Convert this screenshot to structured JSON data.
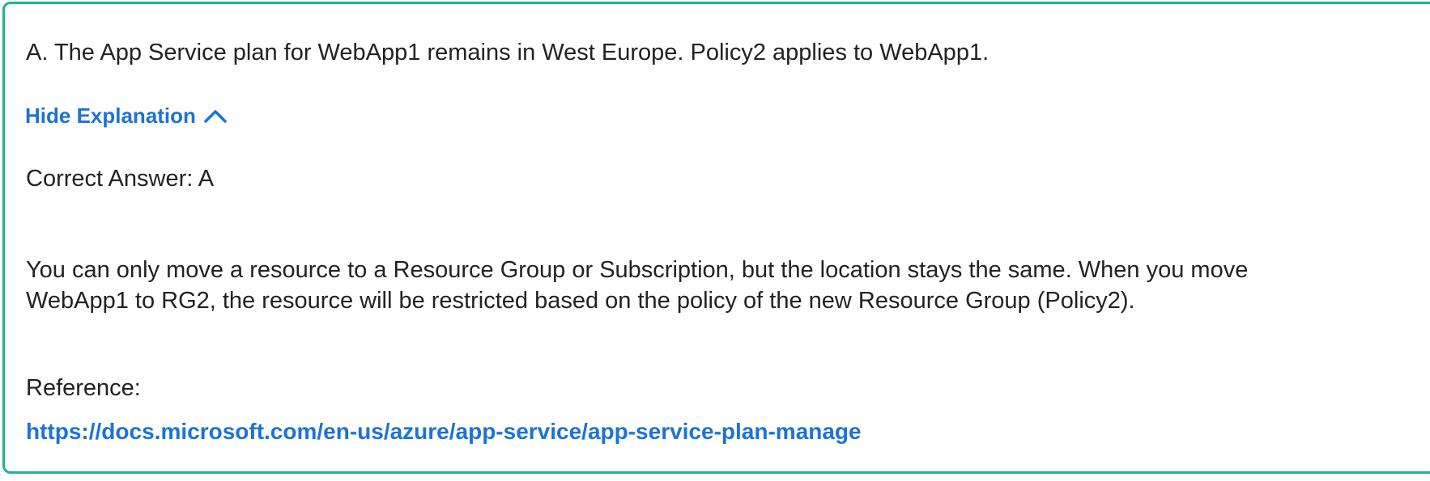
{
  "option": {
    "text": "A. The App Service plan for WebApp1 remains in West Europe. Policy2 applies to WebApp1."
  },
  "explanation_toggle": {
    "label": "Hide Explanation",
    "icon": "chevron-up-icon"
  },
  "correct_answer": {
    "text": "Correct Answer: A"
  },
  "explanation": {
    "lines": [
      "You can only move a resource to a Resource Group or Subscription, but the location stays the same. When you move",
      "WebApp1 to RG2, the resource will be restricted based on the policy of the new Resource Group (Policy2)."
    ]
  },
  "reference": {
    "label": "Reference:",
    "link": "https://docs.microsoft.com/en-us/azure/app-service/app-service-plan-manage"
  },
  "colors": {
    "border": "#1fb493",
    "link": "#1a73d9",
    "text": "#222222"
  }
}
